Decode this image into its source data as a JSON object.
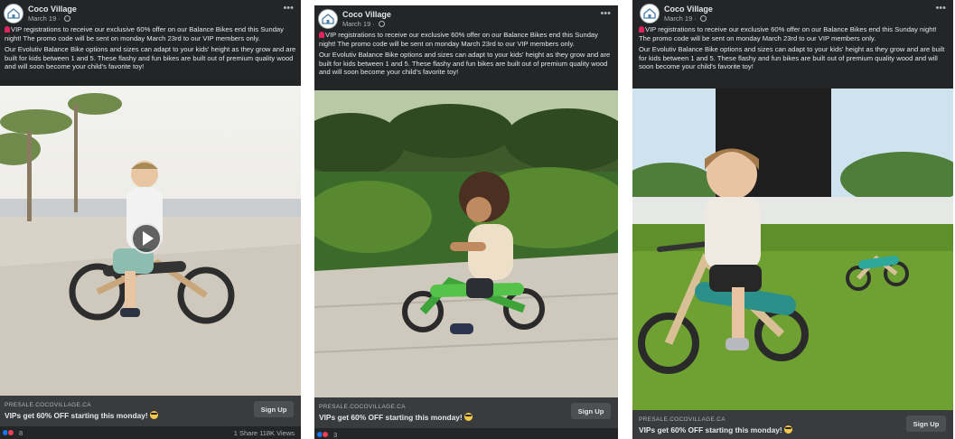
{
  "posts": [
    {
      "page_name": "Coco Village",
      "date": "March 19 · ",
      "text_1": "VIP registrations to receive our exclusive 60% offer on our Balance Bikes end this Sunday night! The promo code will be sent on monday March 23rd to our VIP members only.",
      "text_2": "Our Evolutiv Balance Bike options and sizes can adapt to your kids' height as they grow and are built for kids between 1 and 5. These flashy and fun bikes are built out of premium quality wood and will soon become your child's favorite toy!",
      "link_domain": "PRESALE.COCOVILLAGE.CA",
      "link_title": "VIPs get 60% OFF starting this monday!",
      "cta_label": "Sign Up",
      "reaction_count": "8",
      "share_views": "1 Share 118K Views",
      "media": "video-thumbnail"
    },
    {
      "page_name": "Coco Village",
      "date": "March 19 · ",
      "text_1": "VIP registrations to receive our exclusive 60% offer on our Balance Bikes end this Sunday night! The promo code will be sent on monday March 23rd to our VIP members only.",
      "text_2": "Our Evolutiv Balance Bike options and sizes can adapt to your kids' height as they grow and are built for kids between 1 and 5. These flashy and fun bikes are built out of premium quality wood and will soon become your child's favorite toy!",
      "link_domain": "PRESALE.COCOVILLAGE.CA",
      "link_title": "VIPs get 60% OFF starting this monday!",
      "cta_label": "Sign Up",
      "reaction_count": "3",
      "media": "photo"
    },
    {
      "page_name": "Coco Village",
      "date": "March 19 · ",
      "text_1": "VIP registrations to receive our exclusive 60% offer on our Balance Bikes end this Sunday night! The promo code will be sent on monday March 23rd to our VIP members only.",
      "text_2": "Our Evolutiv Balance Bike options and sizes can adapt to your kids' height as they grow and are built for kids between 1 and 5. These flashy and fun bikes are built out of premium quality wood and will soon become your child's favorite toy!",
      "link_domain": "PRESALE.COCOVILLAGE.CA",
      "link_title": "VIPs get 60% OFF starting this monday!",
      "cta_label": "Sign Up",
      "media": "photo"
    }
  ],
  "colors": {
    "card_bg": "#242526",
    "link_bar_bg": "#3a3b3c",
    "text_primary": "#e4e6eb",
    "text_secondary": "#b0b3b8",
    "like_blue": "#1877f2",
    "love_red": "#f33e58"
  }
}
